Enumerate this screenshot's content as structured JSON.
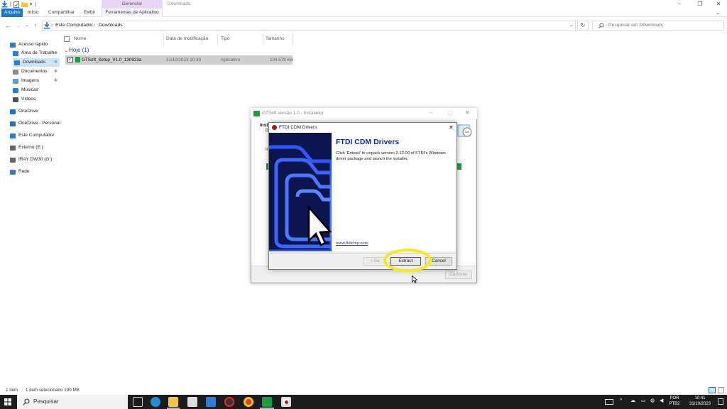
{
  "ribbon": {
    "context_group": "Gerenciar",
    "window_title": "Downloads",
    "tabs": {
      "file": "Arquivo",
      "home": "Início",
      "share": "Compartilhar",
      "view": "Exibir",
      "app_tools": "Ferramentas de Aplicativo"
    }
  },
  "address": {
    "crumbs": [
      "Este Computador",
      "Downloads"
    ],
    "search_placeholder": "Pesquisar em Downloads"
  },
  "nav": [
    {
      "label": "Acesso rápido",
      "icon": "star-icon",
      "color": "#2d7dd2"
    },
    {
      "label": "Área de Trabalho",
      "icon": "desktop-icon",
      "color": "#2d7dd2",
      "pinned": true
    },
    {
      "label": "Downloads",
      "icon": "download-icon",
      "color": "#2d7dd2",
      "pinned": true,
      "selected": true
    },
    {
      "label": "Documentos",
      "icon": "documents-icon",
      "color": "#8a8a8a",
      "pinned": true
    },
    {
      "label": "Imagens",
      "icon": "images-icon",
      "color": "#5ba0d8",
      "pinned": true
    },
    {
      "label": "Músicas",
      "icon": "music-icon",
      "color": "#2d7dd2"
    },
    {
      "label": "Vídeos",
      "icon": "videos-icon",
      "color": "#555555"
    },
    {
      "label": "OneDrive",
      "icon": "cloud-icon",
      "color": "#1e73c9"
    },
    {
      "label": "OneDrive - Personal",
      "icon": "cloud-icon",
      "color": "#1e73c9"
    },
    {
      "label": "Este Computador",
      "icon": "computer-icon",
      "color": "#2d7dd2"
    },
    {
      "label": "Externo (E:)",
      "icon": "drive-icon",
      "color": "#666666"
    },
    {
      "label": "IRAY DW30 (G:)",
      "icon": "drive-icon",
      "color": "#666666"
    },
    {
      "label": "Rede",
      "icon": "network-icon",
      "color": "#2d7dd2"
    }
  ],
  "columns": {
    "name": "Nome",
    "date": "Data de modificação",
    "type": "Tipo",
    "size": "Tamanho"
  },
  "group": "Hoje (1)",
  "file": {
    "name": "GTSoft_Setup_V1.0_130923a",
    "date": "31/10/2023 10:39",
    "type": "Aplicativo",
    "size": "194.578 KB"
  },
  "installer": {
    "title": "GTSoft versão 1.0 - Instalador",
    "partial_heading": "Inst",
    "partial_sub": "Po",
    "partial_line": "In",
    "cancel": "Cancelar"
  },
  "ftdi": {
    "title": "FTDI CDM Drivers",
    "heading": "FTDI CDM Drivers",
    "description": "Click 'Extract' to unpack version 2.12.00 of FTDI's Windows driver package and launch the installer.",
    "link": "www.ftdichip.com",
    "back": "< Ba",
    "extract": "Extract",
    "cancel": "Cancel",
    "accent": "#0d2a9c"
  },
  "status": {
    "count": "1 item",
    "selected": "1 item selecionado 190 MB"
  },
  "taskbar": {
    "search": "Pesquisar",
    "lang": "POR",
    "layout": "PTB2",
    "time": "10:41",
    "date": "31/10/2023"
  }
}
